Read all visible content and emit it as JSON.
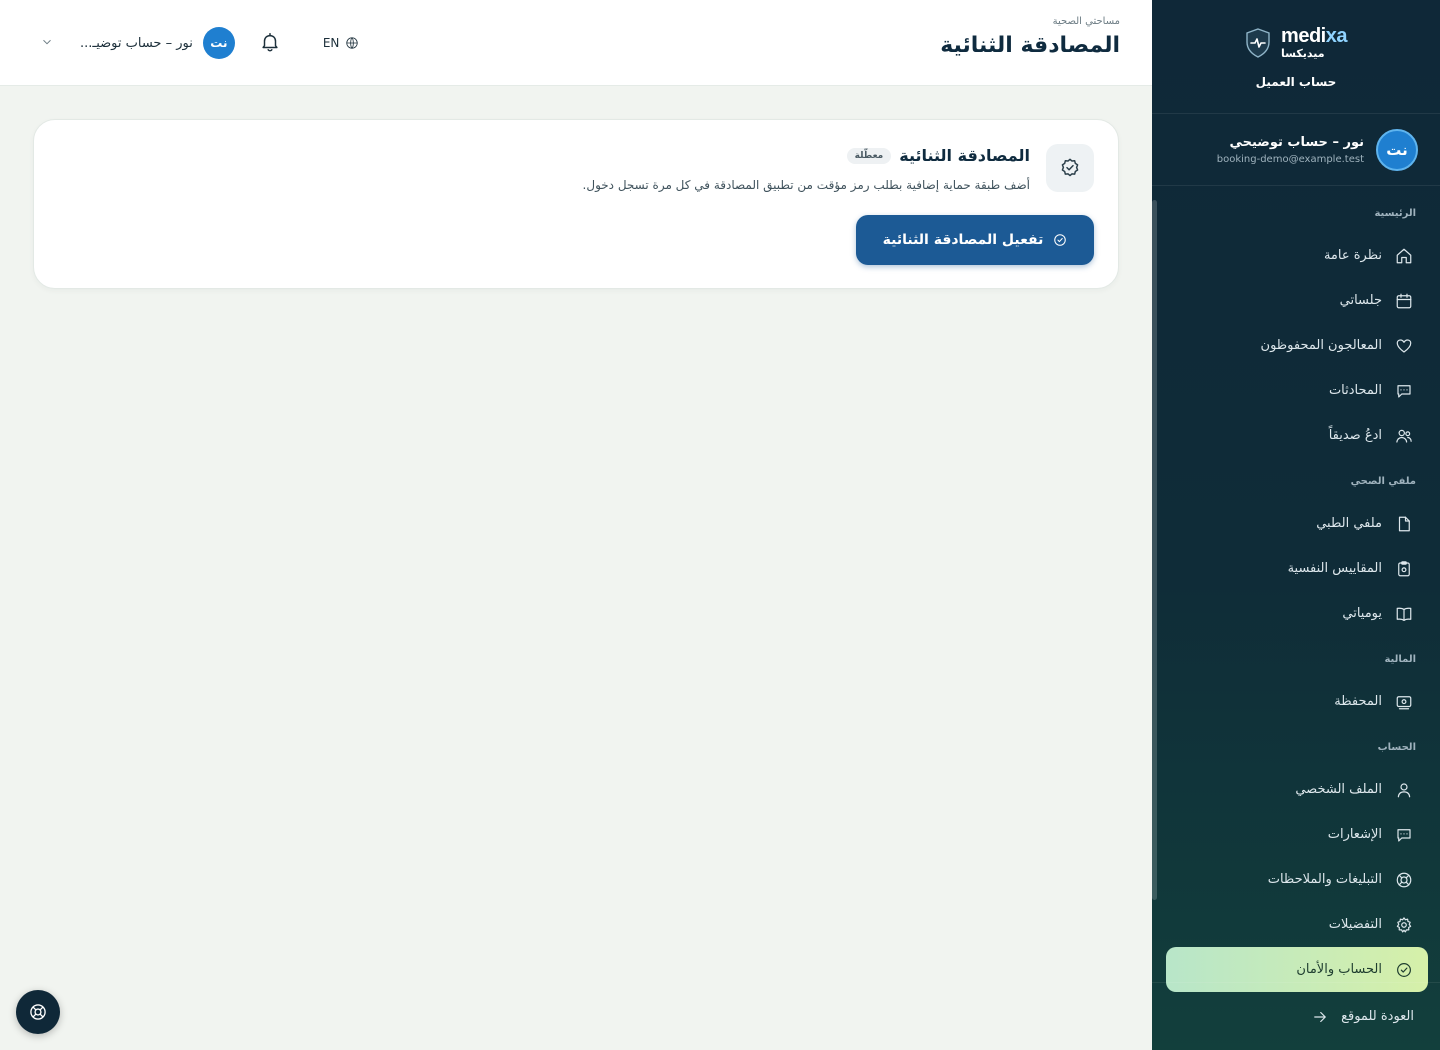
{
  "header": {
    "breadcrumb": "مساحتي الصحية",
    "title": "المصادقة الثنائية",
    "language": "EN",
    "user_initials": "نت",
    "user_name_short": "نور – حساب توضيـ..."
  },
  "sidebar": {
    "brand_en_a": "medi",
    "brand_en_b": "xa",
    "brand_ar": "ميديكسا",
    "subtitle": "حساب العميل",
    "user": {
      "initials": "نت",
      "name": "نور – حساب توضيحي",
      "email": "booking-demo@example.test"
    },
    "sections": [
      {
        "label": "الرئيسية",
        "items": [
          {
            "label": "نظرة عامة",
            "icon": "home-icon"
          },
          {
            "label": "جلساتي",
            "icon": "calendar-icon"
          },
          {
            "label": "المعالجون المحفوظون",
            "icon": "heart-icon"
          },
          {
            "label": "المحادثات",
            "icon": "chat-icon"
          },
          {
            "label": "ادعُ صديقاً",
            "icon": "users-icon"
          }
        ]
      },
      {
        "label": "ملفي الصحي",
        "items": [
          {
            "label": "ملفي الطبي",
            "icon": "file-icon"
          },
          {
            "label": "المقاييس النفسية",
            "icon": "clipboard-icon"
          },
          {
            "label": "يومياتي",
            "icon": "book-icon"
          }
        ]
      },
      {
        "label": "المالية",
        "items": [
          {
            "label": "المحفظة",
            "icon": "wallet-icon"
          }
        ]
      },
      {
        "label": "الحساب",
        "items": [
          {
            "label": "الملف الشخصي",
            "icon": "user-icon"
          },
          {
            "label": "الإشعارات",
            "icon": "message-icon"
          },
          {
            "label": "التبليغات والملاحظات",
            "icon": "lifebuoy-icon"
          },
          {
            "label": "التفضيلات",
            "icon": "gear-icon"
          },
          {
            "label": "الحساب والأمان",
            "icon": "check-circle-icon",
            "active": true
          }
        ]
      }
    ],
    "back_link": "العودة للموقع"
  },
  "card": {
    "title": "المصادقة الثنائية",
    "status": "معطّلة",
    "description": "أضف طبقة حماية إضافية بطلب رمز مؤقت من تطبيق المصادقة في كل مرة تسجل دخول.",
    "button_label": "تفعيل المصادقة الثنائية"
  },
  "colors": {
    "sidebar_bg": "#0f2838",
    "primary": "#1c5a95",
    "active_nav": "#c8ecb8",
    "avatar": "#1f7fd0"
  }
}
